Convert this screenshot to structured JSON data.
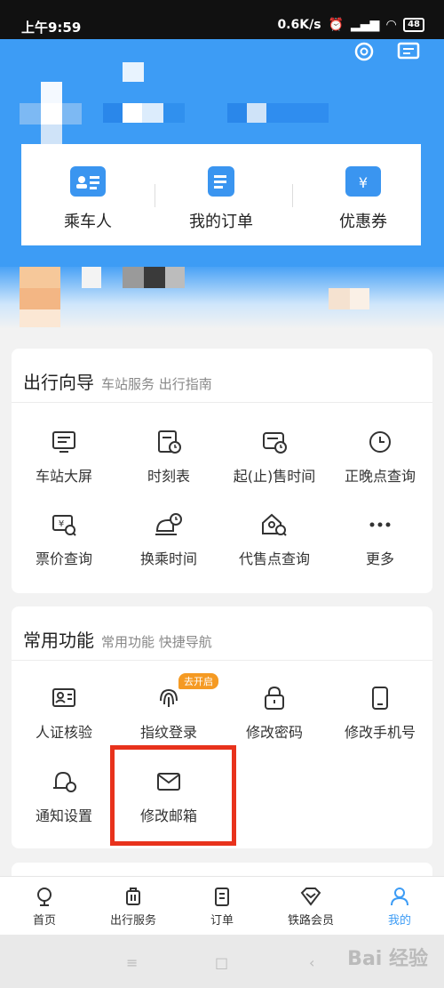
{
  "status_bar": {
    "time": "上午9:59",
    "speed": "0.6K/s",
    "battery": "48"
  },
  "quick_actions": [
    {
      "label": "乘车人",
      "icon": "passenger-card-icon"
    },
    {
      "label": "我的订单",
      "icon": "order-list-icon"
    },
    {
      "label": "优惠券",
      "icon": "coupon-icon"
    }
  ],
  "travel_guide": {
    "title": "出行向导",
    "subtitle": "车站服务 出行指南",
    "items": [
      {
        "label": "车站大屏",
        "icon": "station-screen-icon"
      },
      {
        "label": "时刻表",
        "icon": "timetable-icon"
      },
      {
        "label": "起(止)售时间",
        "icon": "sale-time-icon"
      },
      {
        "label": "正晚点查询",
        "icon": "clock-icon"
      },
      {
        "label": "票价查询",
        "icon": "ticket-price-icon"
      },
      {
        "label": "换乘时间",
        "icon": "transfer-time-icon"
      },
      {
        "label": "代售点查询",
        "icon": "agency-search-icon"
      },
      {
        "label": "更多",
        "icon": "more-dots-icon"
      }
    ]
  },
  "common_functions": {
    "title": "常用功能",
    "subtitle": "常用功能 快捷导航",
    "badge": "去开启",
    "items": [
      {
        "label": "人证核验",
        "icon": "id-verify-icon"
      },
      {
        "label": "指纹登录",
        "icon": "fingerprint-icon"
      },
      {
        "label": "修改密码",
        "icon": "lock-icon"
      },
      {
        "label": "修改手机号",
        "icon": "phone-icon"
      },
      {
        "label": "通知设置",
        "icon": "bell-settings-icon"
      },
      {
        "label": "修改邮箱",
        "icon": "mail-icon"
      }
    ]
  },
  "tab_bar": [
    {
      "label": "首页",
      "icon": "home-icon"
    },
    {
      "label": "出行服务",
      "icon": "luggage-icon"
    },
    {
      "label": "订单",
      "icon": "order-icon"
    },
    {
      "label": "铁路会员",
      "icon": "diamond-icon"
    },
    {
      "label": "我的",
      "icon": "profile-icon",
      "active": true
    }
  ],
  "watermark": "Bai 经验",
  "colors": {
    "primary": "#3d9cf5",
    "highlight": "#e8321c",
    "badge": "#f59a23"
  }
}
